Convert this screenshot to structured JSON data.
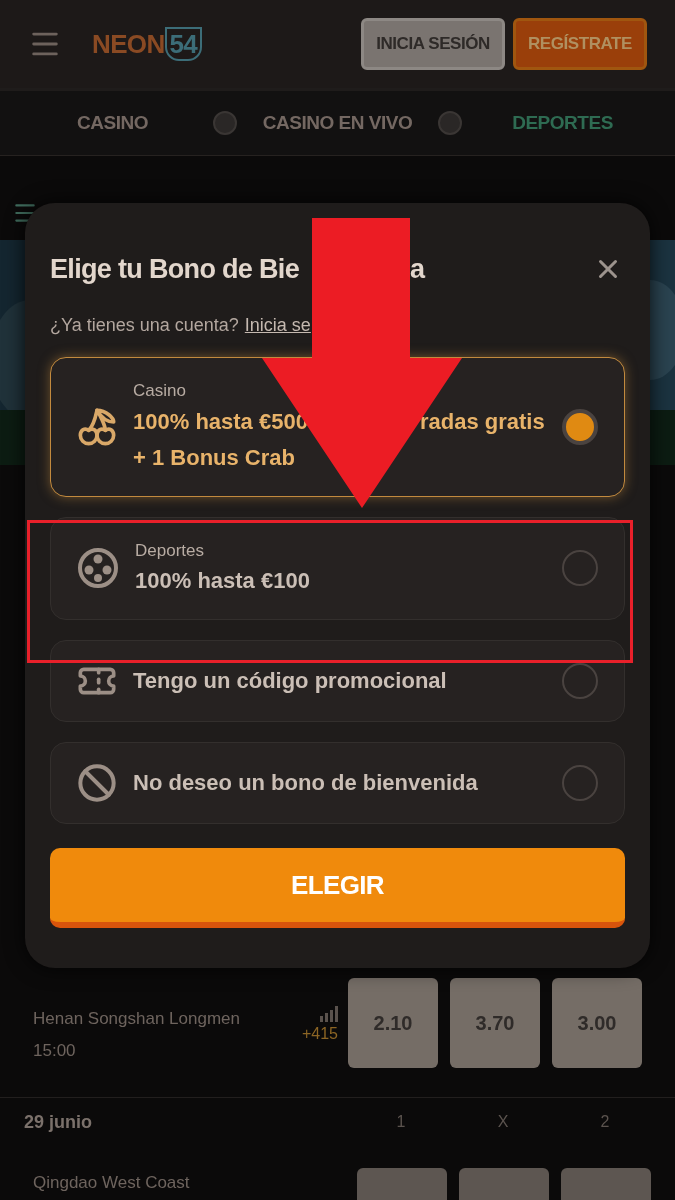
{
  "header": {
    "logo": {
      "word": "NEON",
      "number": "54"
    },
    "buttons": [
      {
        "label": "INICIA SESIÓN",
        "kind": "secondary"
      },
      {
        "label": "REGÍSTRATE",
        "kind": "primary"
      }
    ]
  },
  "nav_tabs": [
    {
      "label": "CASINO",
      "selected": false
    },
    {
      "label": "CASINO EN VIVO",
      "selected": false
    },
    {
      "label": "DEPORTES",
      "selected": true
    }
  ],
  "modal": {
    "title_start": "Elige tu Bono de Bie",
    "title_end": "a",
    "subtitle": "¿Ya tienes una cuenta?",
    "login_link": "Inicia se",
    "options": [
      {
        "kind": "casino",
        "category": "Casino",
        "lines": [
          [
            "100% hasta €500",
            "radas gratis"
          ],
          [
            "+ 1 Bonus Crab"
          ]
        ],
        "selected": true
      },
      {
        "kind": "sports",
        "category": "Deportes",
        "lines": [
          [
            "100% hasta €100"
          ]
        ],
        "selected": false
      },
      {
        "kind": "promo",
        "lines": [
          [
            "Tengo un código promocional"
          ]
        ],
        "selected": false
      },
      {
        "kind": "none",
        "lines": [
          [
            "No deseo un bono de bienvenida"
          ]
        ],
        "selected": false
      }
    ],
    "submit": "ELEGIR"
  },
  "match": {
    "team": "Henan Songshan Longmen",
    "time": "15:00",
    "markets": "+415",
    "odds": [
      "2.10",
      "3.70",
      "3.00"
    ]
  },
  "date_header": {
    "date": "29 junio",
    "columns": [
      "1",
      "X",
      "2"
    ]
  },
  "next_match": {
    "team": "Qingdao West Coast"
  }
}
